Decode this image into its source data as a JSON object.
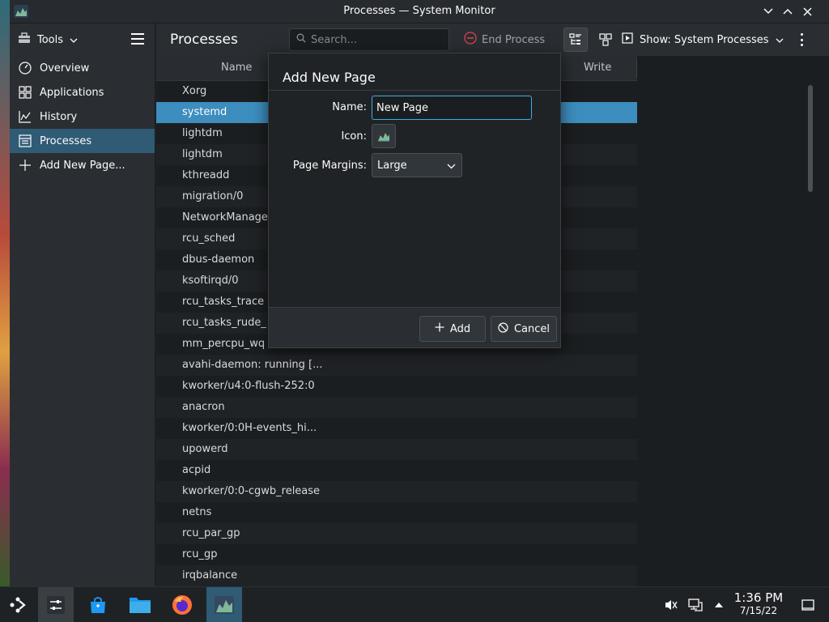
{
  "window": {
    "title": "Processes — System Monitor"
  },
  "toolbar": {
    "tools_label": "Tools",
    "page_title": "Processes",
    "search_placeholder": "Search...",
    "end_process_label": "End Process",
    "show_label": "Show: System Processes"
  },
  "sidebar": {
    "items": [
      {
        "label": "Overview",
        "icon": "overview-icon"
      },
      {
        "label": "Applications",
        "icon": "applications-icon"
      },
      {
        "label": "History",
        "icon": "history-icon"
      },
      {
        "label": "Processes",
        "icon": "processes-icon",
        "active": true
      },
      {
        "label": "Add New Page...",
        "icon": "plus-icon"
      }
    ]
  },
  "table": {
    "columns": [
      "Name",
      "Write"
    ],
    "rows": [
      "Xorg",
      "systemd",
      "lightdm",
      "lightdm",
      "kthreadd",
      "migration/0",
      "NetworkManager",
      "rcu_sched",
      "dbus-daemon",
      "ksoftirqd/0",
      "rcu_tasks_trace",
      "rcu_tasks_rude_",
      "mm_percpu_wq",
      "avahi-daemon: running [...",
      "kworker/u4:0-flush-252:0",
      "anacron",
      "kworker/0:0H-events_hi...",
      "upowerd",
      "acpid",
      "kworker/0:0-cgwb_release",
      "netns",
      "rcu_par_gp",
      "rcu_gp",
      "irqbalance"
    ],
    "selected_index": 1
  },
  "dialog": {
    "title": "Add New Page",
    "name_label": "Name:",
    "name_value": "New Page",
    "icon_label": "Icon:",
    "margins_label": "Page Margins:",
    "margins_value": "Large",
    "add_label": "Add",
    "cancel_label": "Cancel"
  },
  "taskbar": {
    "time": "1:36 PM",
    "date": "7/15/22"
  },
  "colors": {
    "accent": "#3daee9",
    "selection": "#3d8dbf",
    "sidebar_active": "#2f5b75"
  }
}
